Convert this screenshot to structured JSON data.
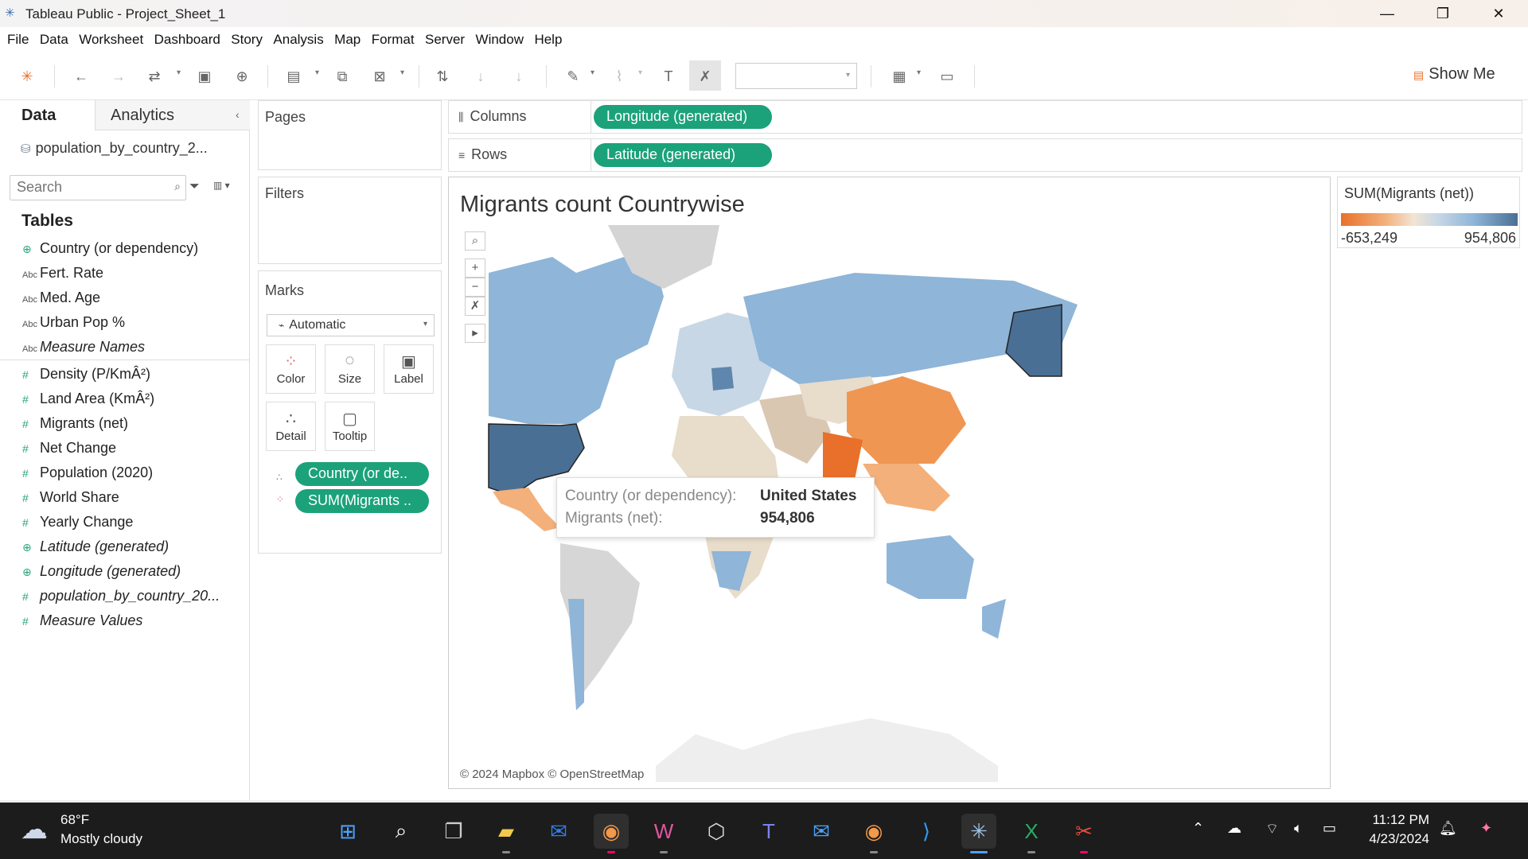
{
  "window": {
    "title": "Tableau Public - Project_Sheet_1"
  },
  "menu": [
    "File",
    "Data",
    "Worksheet",
    "Dashboard",
    "Story",
    "Analysis",
    "Map",
    "Format",
    "Server",
    "Window",
    "Help"
  ],
  "toolbar": {
    "show_me": "Show Me"
  },
  "data_pane": {
    "tabs": {
      "data": "Data",
      "analytics": "Analytics"
    },
    "datasource": "population_by_country_2...",
    "search_placeholder": "Search",
    "tables_header": "Tables",
    "dimensions": [
      {
        "name": "Country (or dependency)",
        "type": "globe"
      },
      {
        "name": "Fert. Rate",
        "type": "Abc"
      },
      {
        "name": "Med. Age",
        "type": "Abc"
      },
      {
        "name": "Urban Pop %",
        "type": "Abc"
      },
      {
        "name": "Measure Names",
        "type": "Abc",
        "italic": true
      }
    ],
    "measures": [
      {
        "name": "Density (P/KmÂ²)",
        "type": "#"
      },
      {
        "name": "Land Area (KmÂ²)",
        "type": "#"
      },
      {
        "name": "Migrants (net)",
        "type": "#"
      },
      {
        "name": "Net Change",
        "type": "#"
      },
      {
        "name": "Population (2020)",
        "type": "#"
      },
      {
        "name": "World Share",
        "type": "#"
      },
      {
        "name": "Yearly Change",
        "type": "#"
      },
      {
        "name": "Latitude (generated)",
        "type": "globe",
        "italic": true
      },
      {
        "name": "Longitude (generated)",
        "type": "globe",
        "italic": true
      },
      {
        "name": "population_by_country_20...",
        "type": "#",
        "italic": true
      },
      {
        "name": "Measure Values",
        "type": "#",
        "italic": true
      }
    ]
  },
  "cards": {
    "pages": "Pages",
    "filters": "Filters",
    "marks": {
      "title": "Marks",
      "type": "Automatic",
      "buttons": [
        "Color",
        "Size",
        "Label",
        "Detail",
        "Tooltip"
      ],
      "pills": [
        "Country (or de..",
        "SUM(Migrants .."
      ]
    }
  },
  "shelves": {
    "columns_label": "Columns",
    "columns_pill": "Longitude (generated)",
    "rows_label": "Rows",
    "rows_pill": "Latitude (generated)"
  },
  "view": {
    "title": "Migrants count Countrywise",
    "attribution": "© 2024 Mapbox © OpenStreetMap",
    "tooltip": {
      "k1": "Country (or dependency):",
      "v1": "United States",
      "k2": "Migrants (net):",
      "v2": "954,806"
    }
  },
  "legend": {
    "title": "SUM(Migrants (net))",
    "min": "-653,249",
    "max": "954,806",
    "colors": {
      "low": "#e8702a",
      "high": "#4a6f95"
    }
  },
  "taskbar": {
    "weather_temp": "68°F",
    "weather_desc": "Mostly cloudy",
    "time": "11:12 PM",
    "date": "4/23/2024"
  }
}
